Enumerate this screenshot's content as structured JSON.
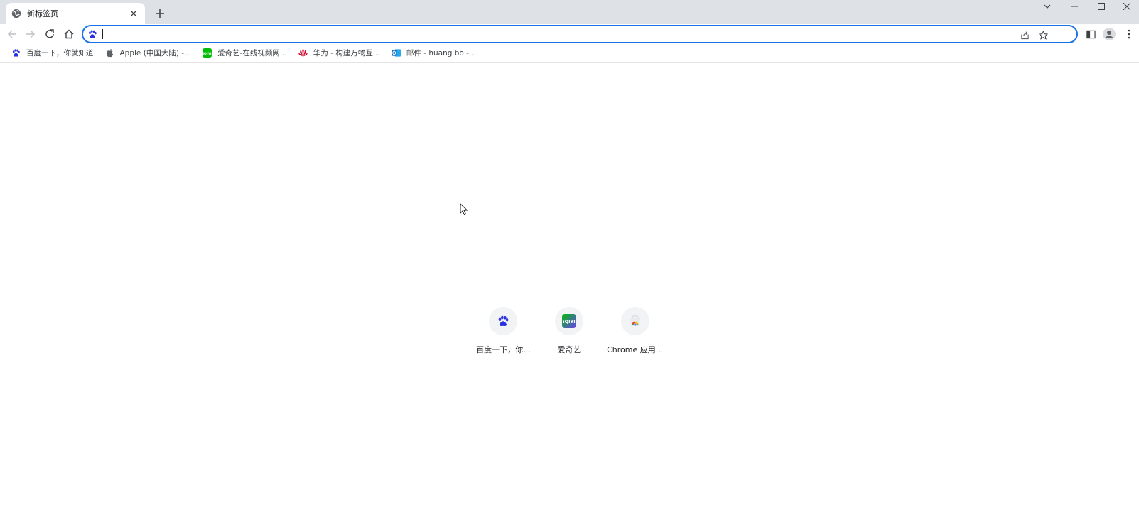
{
  "tab": {
    "title": "新标签页",
    "favicon": "globe-icon"
  },
  "toolbar": {
    "back": "back-arrow-icon",
    "forward": "forward-arrow-icon",
    "reload": "reload-icon",
    "home": "home-icon"
  },
  "omnibox": {
    "value": "",
    "search_engine_icon": "baidu-paw-icon"
  },
  "bookmarks": [
    {
      "label": "百度一下，你就知道",
      "icon": "baidu-paw-icon"
    },
    {
      "label": "Apple (中国大陆) -...",
      "icon": "apple-icon"
    },
    {
      "label": "爱奇艺-在线视频网...",
      "icon": "iqiyi-icon"
    },
    {
      "label": "华为 - 构建万物互...",
      "icon": "huawei-icon"
    },
    {
      "label": "邮件 - huang bo -...",
      "icon": "outlook-icon"
    }
  ],
  "shortcuts": [
    {
      "label": "百度一下，你...",
      "icon": "baidu-paw-icon"
    },
    {
      "label": "爱奇艺",
      "icon": "iqiyi-icon"
    },
    {
      "label": "Chrome 应用...",
      "icon": "chrome-web-store-icon"
    }
  ],
  "colors": {
    "accent": "#1a73e8",
    "tabstrip": "#dee1e6",
    "baidu": "#2932e1",
    "iqiyi": "#00be06",
    "huawei": "#cf0a2c",
    "outlook": "#0f6cbd"
  }
}
